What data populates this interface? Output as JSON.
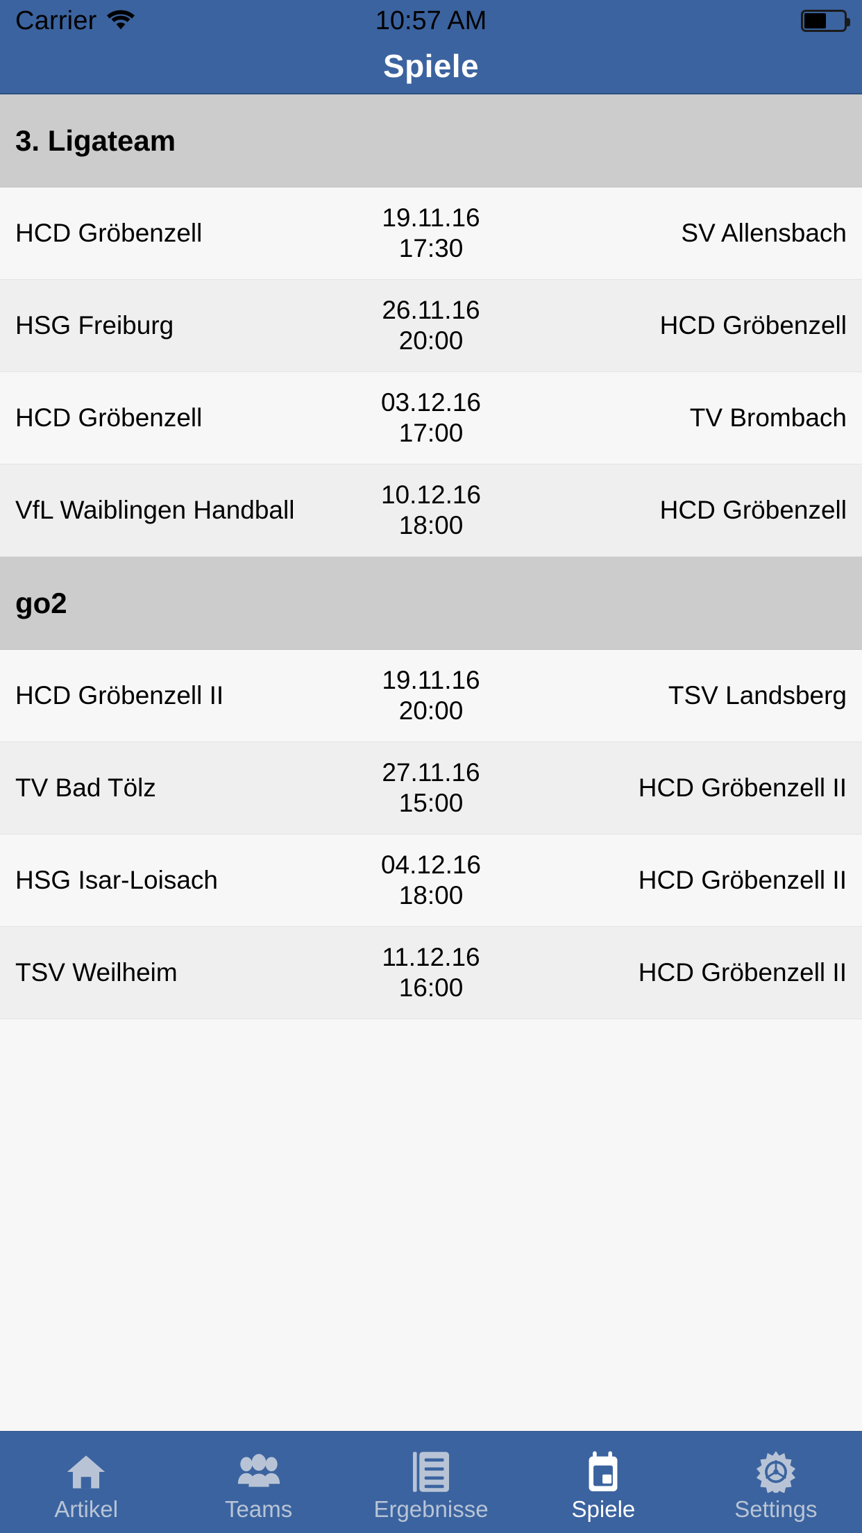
{
  "status_bar": {
    "carrier": "Carrier",
    "wifi_icon": "wifi-icon",
    "time": "10:57 AM",
    "battery_icon": "battery-icon",
    "battery_level_percent": 55
  },
  "nav": {
    "title": "Spiele",
    "bar_color": "#3b639f",
    "title_color": "#ffffff"
  },
  "sections": [
    {
      "title": "3. Ligateam",
      "rows": [
        {
          "home": "HCD Gröbenzell",
          "when": "19.11.16\n17:30",
          "date": "19.11.16",
          "time": "17:30",
          "away": "SV Allensbach"
        },
        {
          "home": "HSG Freiburg",
          "when": "26.11.16\n20:00",
          "date": "26.11.16",
          "time": "20:00",
          "away": "HCD Gröbenzell"
        },
        {
          "home": "HCD Gröbenzell",
          "when": "03.12.16\n17:00",
          "date": "03.12.16",
          "time": "17:00",
          "away": "TV Brombach"
        },
        {
          "home": "VfL Waiblingen Handball",
          "when": "10.12.16\n18:00",
          "date": "10.12.16",
          "time": "18:00",
          "away": "HCD Gröbenzell"
        }
      ]
    },
    {
      "title": "go2",
      "rows": [
        {
          "home": "HCD Gröbenzell II",
          "when": "19.11.16\n20:00",
          "date": "19.11.16",
          "time": "20:00",
          "away": "TSV Landsberg"
        },
        {
          "home": "TV Bad Tölz",
          "when": "27.11.16\n15:00",
          "date": "27.11.16",
          "time": "15:00",
          "away": "HCD Gröbenzell II"
        },
        {
          "home": "HSG Isar-Loisach",
          "when": "04.12.16\n18:00",
          "date": "04.12.16",
          "time": "18:00",
          "away": "HCD Gröbenzell II"
        },
        {
          "home": "TSV Weilheim",
          "when": "11.12.16\n16:00",
          "date": "11.12.16",
          "time": "16:00",
          "away": "HCD Gröbenzell II"
        }
      ]
    }
  ],
  "tabbar": {
    "bar_color": "#3b639f",
    "inactive_color": "#b8c4d6",
    "active_color": "#ffffff",
    "tabs": [
      {
        "label": "Artikel",
        "icon": "home-icon",
        "active": false
      },
      {
        "label": "Teams",
        "icon": "people-icon",
        "active": false
      },
      {
        "label": "Ergebnisse",
        "icon": "document-icon",
        "active": false
      },
      {
        "label": "Spiele",
        "icon": "calendar-icon",
        "active": true
      },
      {
        "label": "Settings",
        "icon": "gear-icon",
        "active": false
      }
    ]
  }
}
